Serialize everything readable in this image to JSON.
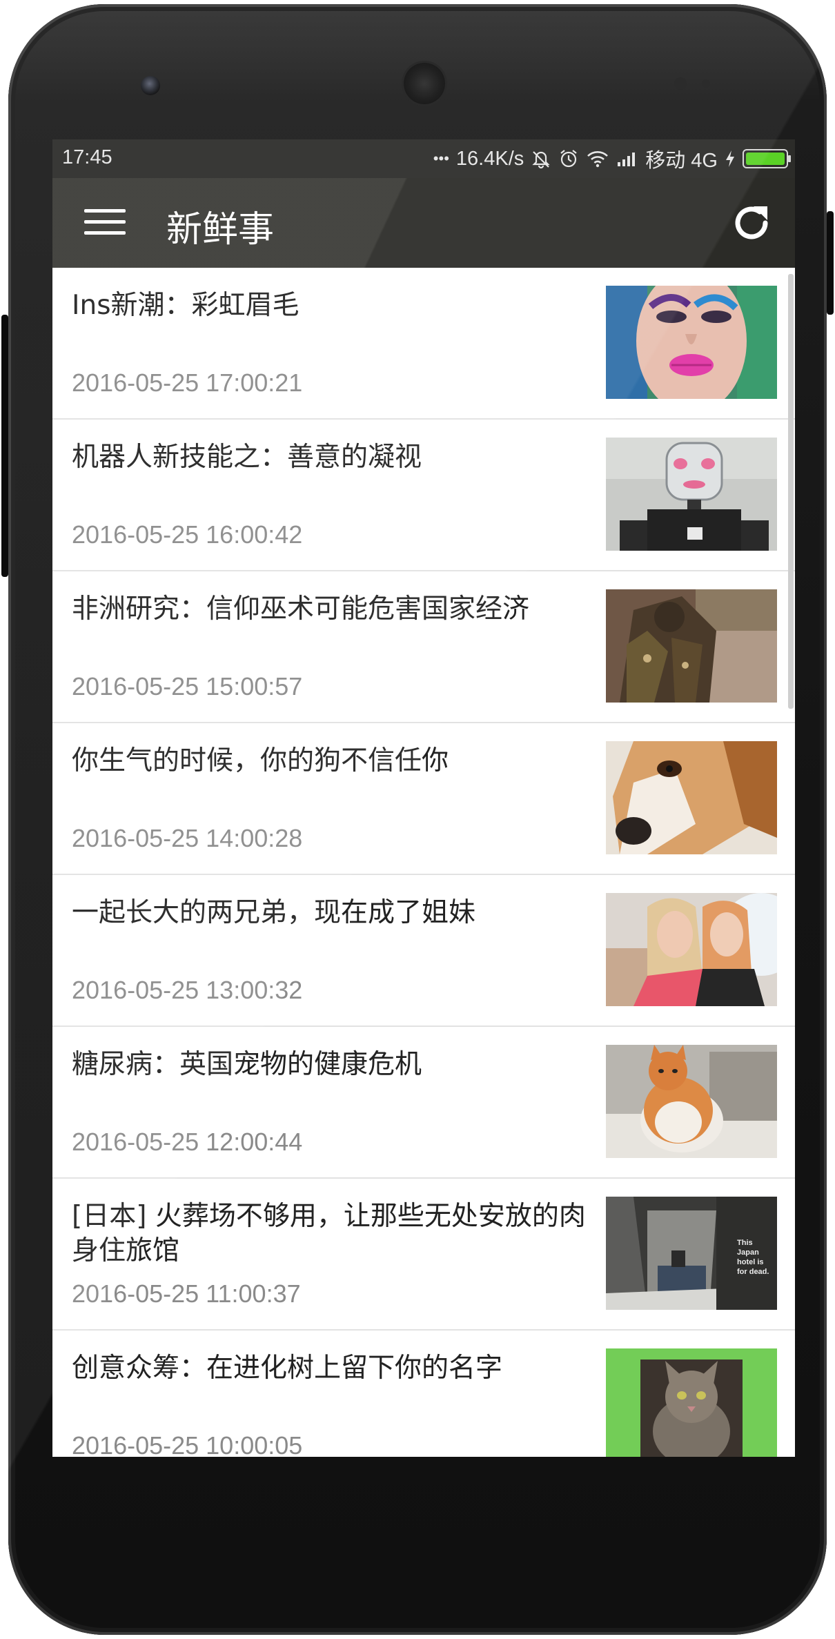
{
  "statusbar": {
    "time": "17:45",
    "dots": "•••",
    "speed": "16.4K/s",
    "carrier": "移动 4G",
    "icons": [
      "mute-icon",
      "alarm-icon",
      "wifi-icon",
      "signal-icon",
      "charging-icon",
      "battery-icon"
    ],
    "battery_color": "#5ad126"
  },
  "appbar": {
    "title": "新鲜事",
    "menu_icon": "menu-icon",
    "refresh_icon": "refresh-icon"
  },
  "articles": [
    {
      "title": "Ins新潮：彩虹眉毛",
      "date": "2016-05-25 17:00:21"
    },
    {
      "title": "机器人新技能之：善意的凝视",
      "date": "2016-05-25 16:00:42"
    },
    {
      "title": "非洲研究：信仰巫术可能危害国家经济",
      "date": "2016-05-25 15:00:57"
    },
    {
      "title": "你生气的时候，你的狗不信任你",
      "date": "2016-05-25 14:00:28"
    },
    {
      "title": "一起长大的两兄弟，现在成了姐妹",
      "date": "2016-05-25 13:00:32"
    },
    {
      "title": "糖尿病：英国宠物的健康危机",
      "date": "2016-05-25 12:00:44"
    },
    {
      "title": "[日本] 火葬场不够用，让那些无处安放的肉身住旅馆",
      "date": "2016-05-25 11:00:37",
      "thumb_text": "This Japan hotel is for dead."
    },
    {
      "title": "创意众筹：在进化树上留下你的名字",
      "date": "2016-05-25 10:00:05"
    }
  ]
}
